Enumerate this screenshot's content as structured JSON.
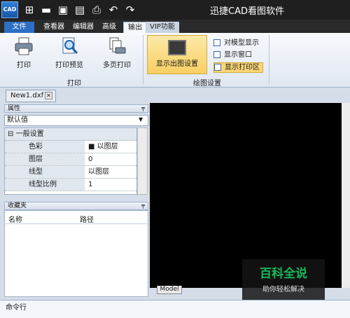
{
  "app": {
    "title": "迅捷CAD看图软件",
    "logo_text": "CAD"
  },
  "tabs": [
    "文件",
    "查看器",
    "编辑器",
    "高级",
    "输出",
    "VIP功能"
  ],
  "ribbon": {
    "print_group": {
      "label": "打印",
      "buttons": [
        "打印",
        "打印预览",
        "多页打印"
      ]
    },
    "draw_group": {
      "label": "绘图设置",
      "main_button": "显示出图设置",
      "options": [
        "对模型显示",
        "显示窗口",
        "显示打印区"
      ]
    }
  },
  "document_tab": "New1.dxf",
  "properties": {
    "title": "属性",
    "selected": "默认值",
    "section": "一般设置",
    "rows": [
      {
        "name": "色彩",
        "value": "以图层"
      },
      {
        "name": "图层",
        "value": "0"
      },
      {
        "name": "线型",
        "value": "以图层"
      },
      {
        "name": "线型比例",
        "value": "1"
      }
    ]
  },
  "favorites": {
    "title": "收藏夹",
    "columns": [
      "名称",
      "路径"
    ]
  },
  "canvas": {
    "model_tab": "Model"
  },
  "watermark": {
    "title": "百科全说",
    "subtitle": "助你轻松解决"
  },
  "command": {
    "label": "命令行"
  }
}
